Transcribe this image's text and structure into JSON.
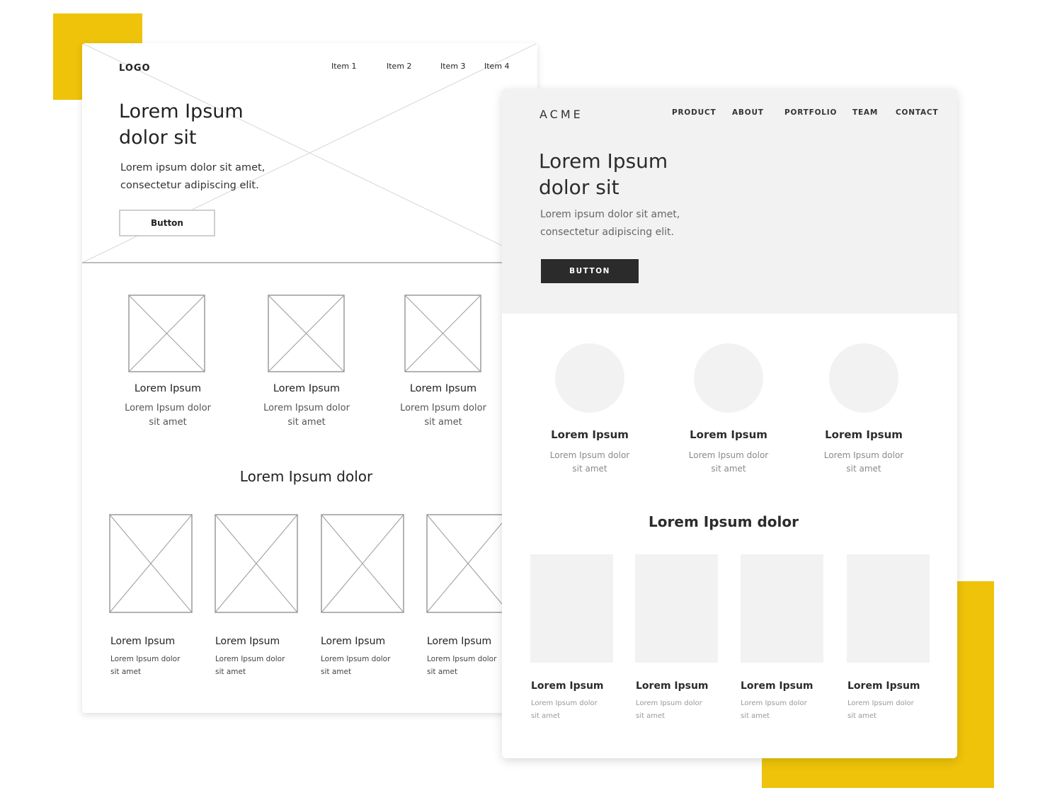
{
  "colors": {
    "accent": "#EEC30A",
    "clean_hero_bg": "#F2F2F2",
    "clean_button_bg": "#2B2B2B",
    "sketch_line": "#BCBCBC"
  },
  "sketch": {
    "logo": "LOGO",
    "nav": [
      "Item 1",
      "Item 2",
      "Item 3",
      "Item 4"
    ],
    "hero": {
      "title_line1": "Lorem Ipsum",
      "title_line2": "dolor sit",
      "sub_line1": "Lorem ipsum dolor sit amet,",
      "sub_line2": "consectetur adipiscing elit.",
      "button": "Button",
      "image_icon": "image-placeholder-icon"
    },
    "features": [
      {
        "title": "Lorem Ipsum",
        "desc_line1": "Lorem Ipsum dolor",
        "desc_line2": "sit amet"
      },
      {
        "title": "Lorem Ipsum",
        "desc_line1": "Lorem Ipsum dolor",
        "desc_line2": "sit amet"
      },
      {
        "title": "Lorem Ipsum",
        "desc_line1": "Lorem Ipsum dolor",
        "desc_line2": "sit amet"
      }
    ],
    "section_title": "Lorem Ipsum dolor",
    "cards": [
      {
        "title": "Lorem Ipsum",
        "desc_line1": "Lorem Ipsum dolor",
        "desc_line2": "sit amet"
      },
      {
        "title": "Lorem Ipsum",
        "desc_line1": "Lorem Ipsum dolor",
        "desc_line2": "sit amet"
      },
      {
        "title": "Lorem Ipsum",
        "desc_line1": "Lorem Ipsum dolor",
        "desc_line2": "sit amet"
      },
      {
        "title": "Lorem Ipsum",
        "desc_line1": "Lorem Ipsum dolor",
        "desc_line2": "sit amet"
      }
    ]
  },
  "clean": {
    "logo": "ACME",
    "nav": [
      "PRODUCT",
      "ABOUT",
      "PORTFOLIO",
      "TEAM",
      "CONTACT"
    ],
    "hero": {
      "title_line1": "Lorem Ipsum",
      "title_line2": "dolor sit",
      "sub_line1": "Lorem ipsum dolor sit amet,",
      "sub_line2": "consectetur adipiscing elit.",
      "button": "BUTTON"
    },
    "features": [
      {
        "title": "Lorem Ipsum",
        "desc_line1": "Lorem Ipsum dolor",
        "desc_line2": "sit amet"
      },
      {
        "title": "Lorem Ipsum",
        "desc_line1": "Lorem Ipsum dolor",
        "desc_line2": "sit amet"
      },
      {
        "title": "Lorem Ipsum",
        "desc_line1": "Lorem Ipsum dolor",
        "desc_line2": "sit amet"
      }
    ],
    "section_title": "Lorem Ipsum dolor",
    "cards": [
      {
        "title": "Lorem Ipsum",
        "desc_line1": "Lorem Ipsum dolor",
        "desc_line2": "sit amet"
      },
      {
        "title": "Lorem Ipsum",
        "desc_line1": "Lorem Ipsum dolor",
        "desc_line2": "sit amet"
      },
      {
        "title": "Lorem Ipsum",
        "desc_line1": "Lorem Ipsum dolor",
        "desc_line2": "sit amet"
      },
      {
        "title": "Lorem Ipsum",
        "desc_line1": "Lorem Ipsum dolor",
        "desc_line2": "sit amet"
      }
    ]
  }
}
